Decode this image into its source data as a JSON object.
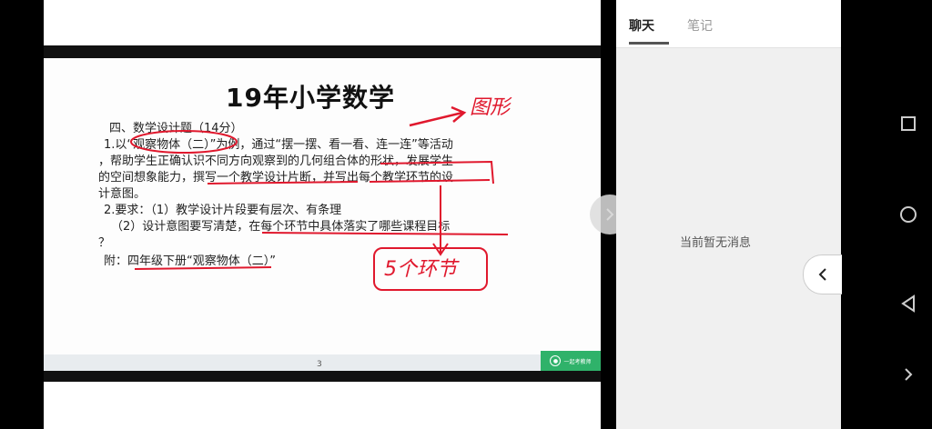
{
  "slide": {
    "title": "19年小学数学",
    "lines": [
      "四、数学设计题（14分）",
      "1.以“观察物体（二）”为例，通过“摆一摆、看一看、连一连”等活动",
      "，帮助学生正确认识不同方向观察到的几何组合体的形状，发展学生",
      "的空间想象能力，撰写一个教学设计片断，并写出每个教学环节的设",
      "计意图。",
      "2.要求：（1）教学设计片段要有层次、有条理",
      "（2）设计意图要写清楚，在每个环节中具体落实了哪些课程目标",
      "？",
      "附：四年级下册“观察物体（二）”"
    ],
    "annotation_top": "图形",
    "annotation_box": "5个环节",
    "page_number": "3",
    "logo_text": "一起考教师"
  },
  "panel": {
    "tabs": [
      {
        "label": "聊天"
      },
      {
        "label": "笔记"
      }
    ],
    "empty_message": "当前暂无消息"
  },
  "colors": {
    "annotation": "#e0182d",
    "logo": "#2fb26a"
  }
}
